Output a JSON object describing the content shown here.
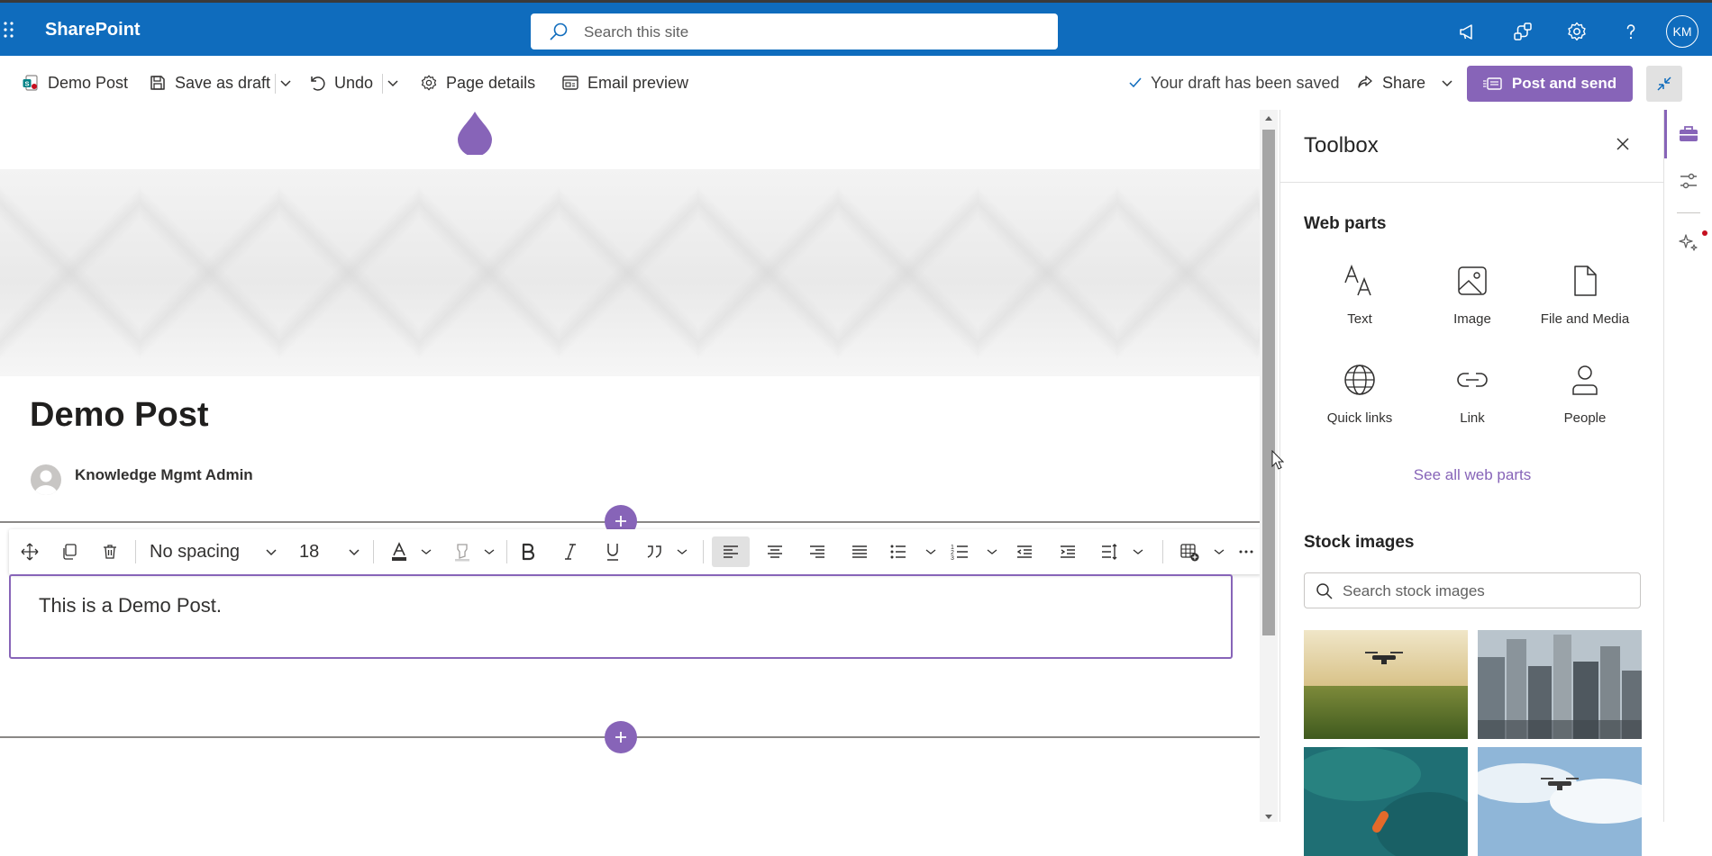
{
  "suite": {
    "brand": "SharePoint",
    "search_placeholder": "Search this site",
    "avatar_initials": "KM"
  },
  "commandbar": {
    "page_name": "Demo Post",
    "save_draft": "Save as draft",
    "undo": "Undo",
    "page_details": "Page details",
    "email_preview": "Email preview",
    "saved_status": "Your draft has been saved",
    "share": "Share",
    "post_and_send": "Post and send"
  },
  "page": {
    "title": "Demo Post",
    "author": "Knowledge Mgmt Admin",
    "body_text": "This is a Demo Post."
  },
  "format_toolbar": {
    "paragraph_style": "No spacing",
    "font_size": "18"
  },
  "toolbox": {
    "title": "Toolbox",
    "web_parts_title": "Web parts",
    "web_parts": [
      {
        "label": "Text",
        "icon": "text-icon"
      },
      {
        "label": "Image",
        "icon": "image-icon"
      },
      {
        "label": "File and Media",
        "icon": "file-icon"
      },
      {
        "label": "Quick links",
        "icon": "globe-icon"
      },
      {
        "label": "Link",
        "icon": "link-icon"
      },
      {
        "label": "People",
        "icon": "person-icon"
      }
    ],
    "see_all": "See all web parts",
    "stock_title": "Stock images",
    "stock_search_placeholder": "Search stock images"
  },
  "colors": {
    "suite_blue": "#0f6cbd",
    "accent_purple": "#8764b8"
  }
}
